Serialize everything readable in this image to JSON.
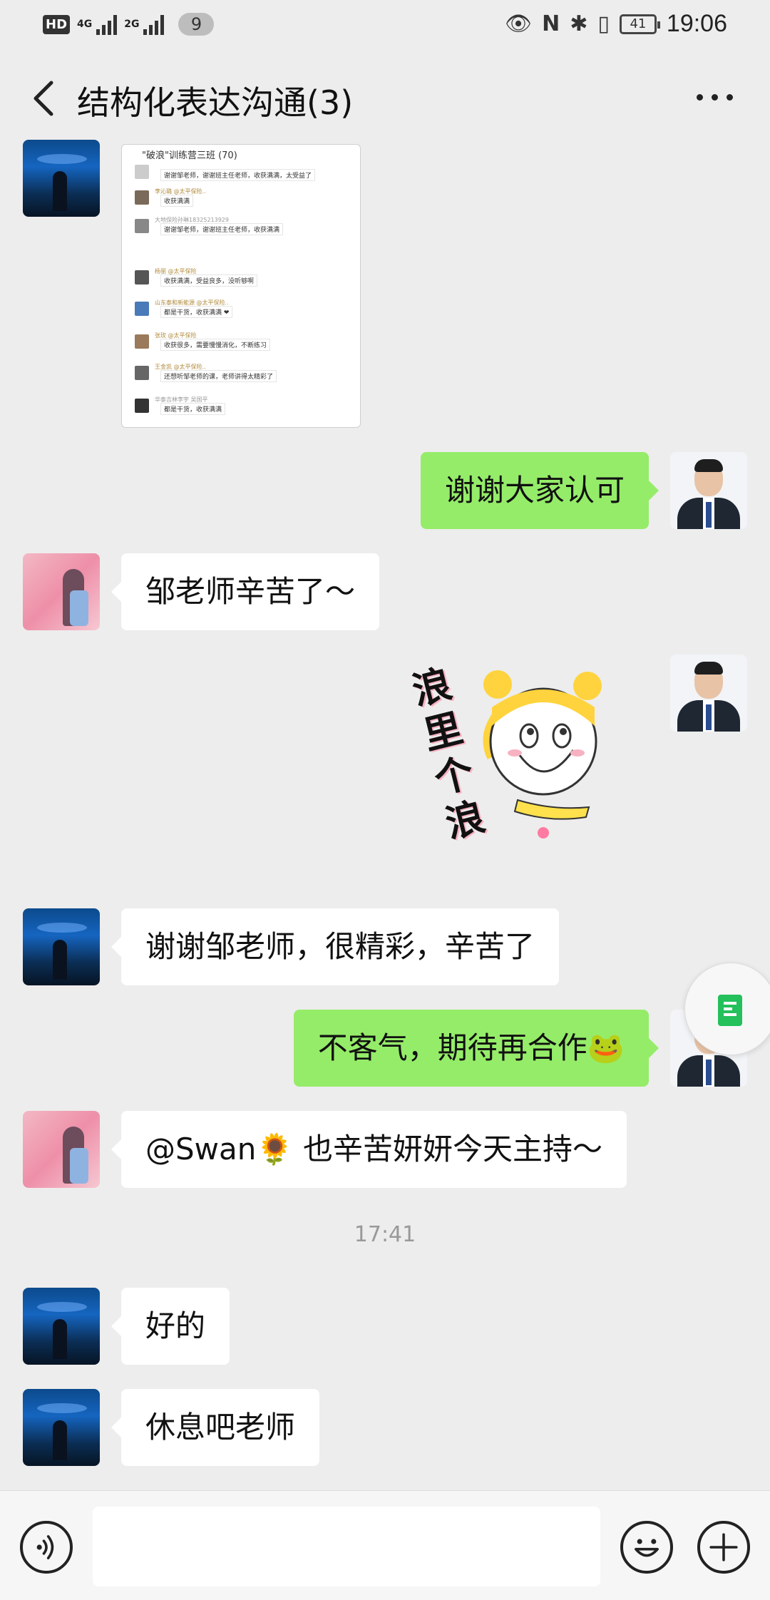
{
  "status_bar": {
    "hd": "HD",
    "net1": "4G",
    "net2": "2G",
    "notifications": "9",
    "battery": "41",
    "time": "19:06"
  },
  "header": {
    "title": "结构化表达沟通(3)"
  },
  "shared_screenshot": {
    "title": "\"破浪\"训练营三班 (70)",
    "rows": [
      {
        "name": "",
        "text": "谢谢邹老师，谢谢班主任老师，收获满满，太受益了"
      },
      {
        "name": "李沁璐 @太平保险..",
        "text": "收获满满"
      },
      {
        "name": "大地保险孙琳18325213929",
        "text": "谢谢邹老师，谢谢班主任老师，收获满满"
      },
      {
        "name": "杨丽 @太平保险",
        "text": "收获满满，受益良多，没听够啊"
      },
      {
        "name": "山东泰和新能源 @太平保险..",
        "text": "都是干货，收获满满 ❤"
      },
      {
        "name": "张玫 @太平保险",
        "text": "收获很多，需要慢慢消化，不断练习"
      },
      {
        "name": "王金凯 @太平保险..",
        "text": "还想听邹老师的课，老师讲得太精彩了"
      },
      {
        "name": "华泰吉林李宇 吴国平",
        "text": "都是干货，收获满满"
      }
    ]
  },
  "messages": [
    {
      "side": "right",
      "text": "谢谢大家认可"
    },
    {
      "side": "left",
      "text": "邹老师辛苦了～"
    },
    {
      "side": "left",
      "text": "谢谢邹老师，很精彩，辛苦了"
    },
    {
      "side": "right",
      "text": "不客气，期待再合作🐸"
    },
    {
      "side": "left",
      "text": "@Swan🌻 也辛苦妍妍今天主持～"
    },
    {
      "side": "left",
      "text": "好的"
    },
    {
      "side": "left",
      "text": "休息吧老师"
    }
  ],
  "sticker": {
    "text": "浪里个浪"
  },
  "timestamp": "17:41",
  "input": {
    "value": ""
  },
  "icons": {
    "back": "chevron-left-icon",
    "more": "more-dots-icon",
    "voice": "voice-icon",
    "emoji": "emoji-icon",
    "plus": "plus-icon",
    "doc": "document-icon"
  },
  "colors": {
    "background": "#ededed",
    "right_bubble": "#95ec69",
    "left_bubble": "#ffffff",
    "doc_green": "#23c05c"
  }
}
